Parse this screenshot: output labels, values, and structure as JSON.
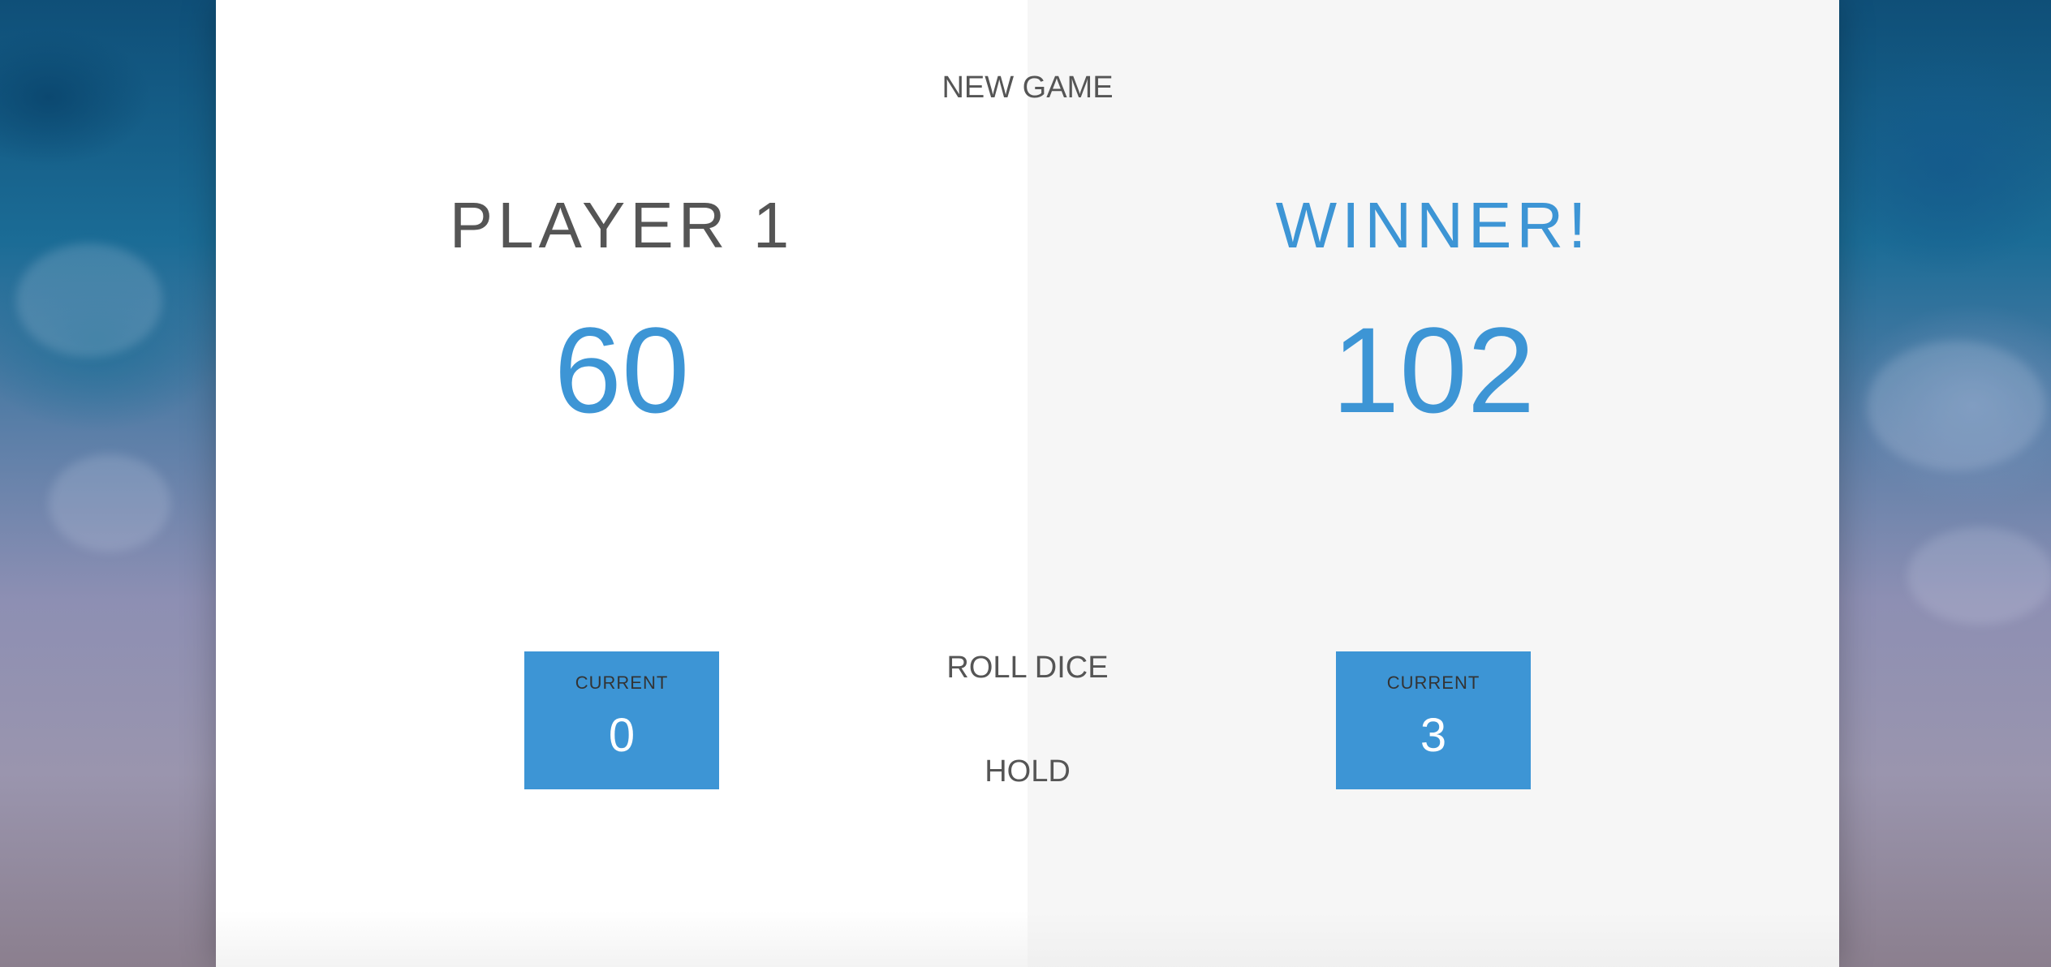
{
  "game": {
    "new_game_label": "NEW GAME",
    "roll_dice_label": "ROLL DICE",
    "hold_label": "HOLD",
    "players": [
      {
        "name": "PLAYER 1",
        "score": "60",
        "current_label": "CURRENT",
        "current_score": "0"
      },
      {
        "name": "WINNER!",
        "score": "102",
        "current_label": "CURRENT",
        "current_score": "3"
      }
    ]
  },
  "colors": {
    "accent": "#3d95d5",
    "active_panel": "#f6f6f6",
    "text": "#555555"
  }
}
